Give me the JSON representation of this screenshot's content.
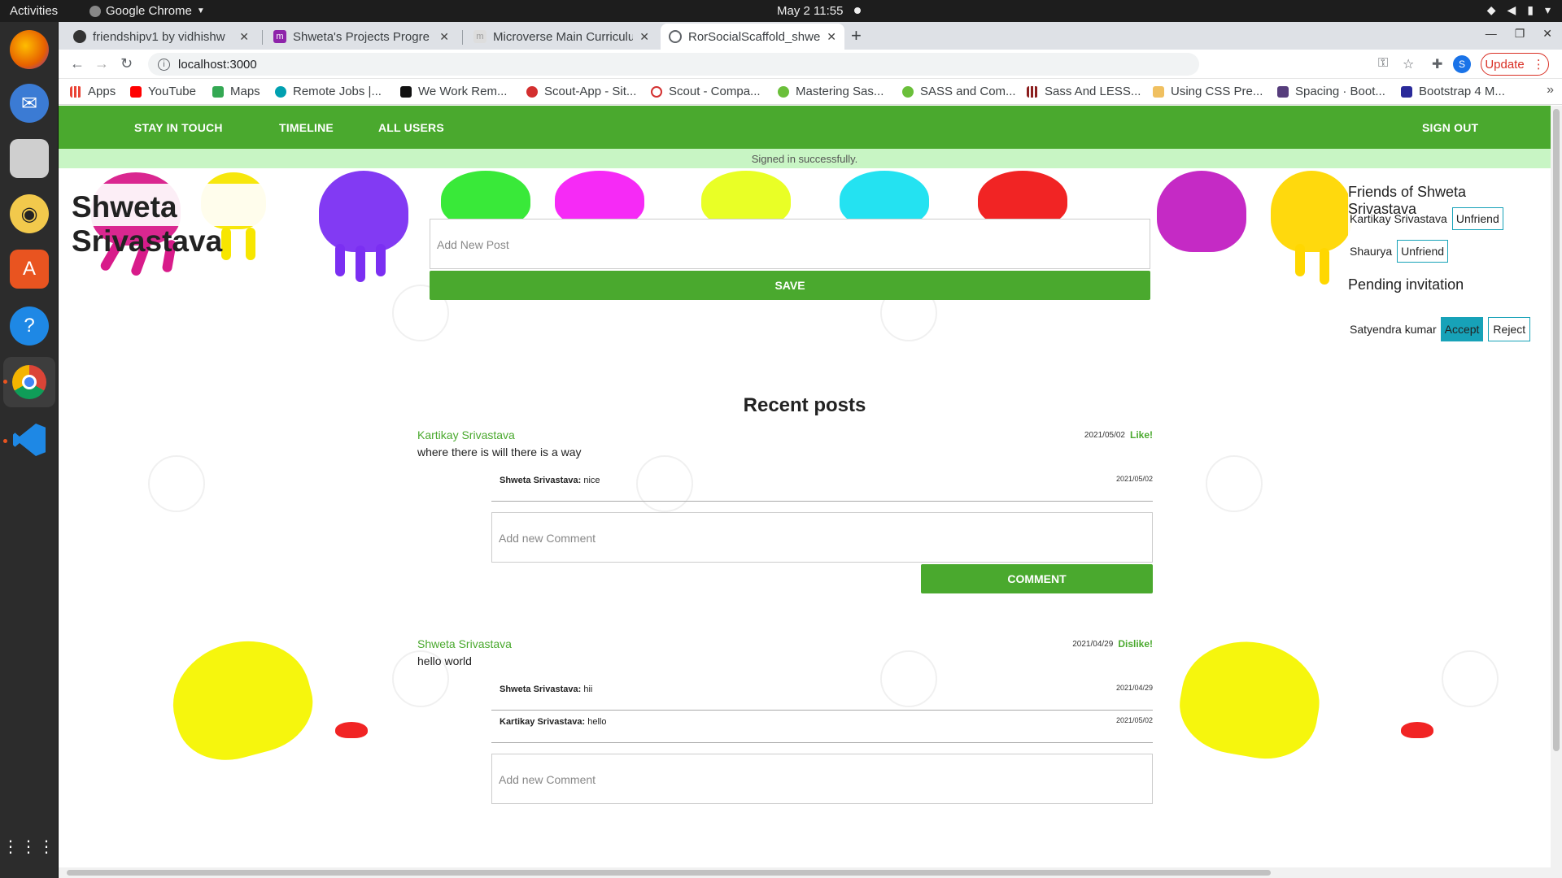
{
  "os": {
    "activities": "Activities",
    "app_menu": "Google Chrome",
    "clock": "May 2  11:55"
  },
  "browser": {
    "tabs": [
      {
        "title": "friendshipv1 by vidhishw"
      },
      {
        "title": "Shweta's Projects Progre"
      },
      {
        "title": "Microverse Main Curriculu"
      },
      {
        "title": "RorSocialScaffold_shweta"
      }
    ],
    "url": "localhost:3000",
    "avatar_letter": "S",
    "update_label": "Update",
    "bookmarks": [
      {
        "label": "Apps"
      },
      {
        "label": "YouTube"
      },
      {
        "label": "Maps"
      },
      {
        "label": "Remote Jobs |..."
      },
      {
        "label": "We Work Rem..."
      },
      {
        "label": "Scout-App - Sit..."
      },
      {
        "label": "Scout - Compa..."
      },
      {
        "label": "Mastering Sas..."
      },
      {
        "label": "SASS and Com..."
      },
      {
        "label": "Sass And LESS..."
      },
      {
        "label": "Using CSS Pre..."
      },
      {
        "label": "Spacing · Boot..."
      },
      {
        "label": "Bootstrap 4 M..."
      }
    ]
  },
  "nav": {
    "stay_in_touch": "STAY IN TOUCH",
    "timeline": "TIMELINE",
    "all_users": "ALL USERS",
    "sign_out": "SIGN OUT"
  },
  "notice": "Signed in successfully.",
  "profile": {
    "name": "Shweta Srivastava"
  },
  "new_post": {
    "placeholder": "Add New Post",
    "save_label": "SAVE"
  },
  "friends": {
    "title": "Friends of Shweta Srivastava",
    "list": [
      {
        "name": "Kartikay Srivastava",
        "action": "Unfriend"
      },
      {
        "name": "Shaurya",
        "action": "Unfriend"
      }
    ],
    "pending_title": "Pending invitation",
    "pending": [
      {
        "name": "Satyendra kumar",
        "accept": "Accept",
        "reject": "Reject"
      }
    ]
  },
  "recent_title": "Recent posts",
  "posts": [
    {
      "author": "Kartikay Srivastava",
      "date": "2021/05/02",
      "like_label": "Like!",
      "body": "where there is will there is a way",
      "comments": [
        {
          "author": "Shweta Srivastava:",
          "text": "nice",
          "date": "2021/05/02"
        }
      ],
      "comment_placeholder": "Add new Comment",
      "comment_button": "COMMENT"
    },
    {
      "author": "Shweta Srivastava",
      "date": "2021/04/29",
      "like_label": "Dislike!",
      "body": "hello world",
      "comments": [
        {
          "author": "Shweta Srivastava:",
          "text": "hii",
          "date": "2021/04/29"
        },
        {
          "author": "Kartikay Srivastava:",
          "text": "hello",
          "date": "2021/05/02"
        }
      ],
      "comment_placeholder": "Add new Comment"
    }
  ],
  "colors": {
    "brand_green": "#4aa92e",
    "notice_bg": "#c8f5c4",
    "accent_teal": "#17a2b8"
  }
}
